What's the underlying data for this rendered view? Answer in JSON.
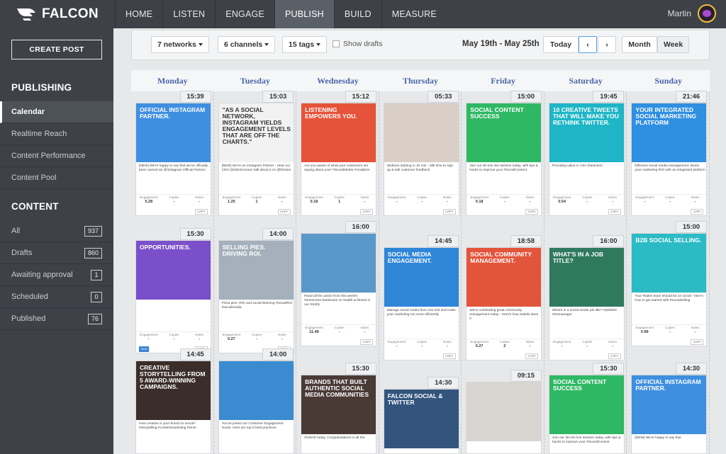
{
  "brand": {
    "name": "FALCON"
  },
  "nav": [
    "HOME",
    "LISTEN",
    "ENGAGE",
    "PUBLISH",
    "BUILD",
    "MEASURE"
  ],
  "nav_active": "PUBLISH",
  "user": {
    "name": "Martin"
  },
  "sidebar": {
    "create_post": "CREATE POST",
    "publishing_title": "PUBLISHING",
    "publishing_items": [
      {
        "label": "Calendar",
        "active": true
      },
      {
        "label": "Realtime Reach"
      },
      {
        "label": "Content Performance"
      },
      {
        "label": "Content Pool"
      }
    ],
    "content_title": "CONTENT",
    "content_items": [
      {
        "label": "All",
        "count": "937"
      },
      {
        "label": "Drafts",
        "count": "860"
      },
      {
        "label": "Awaiting approval",
        "count": "1"
      },
      {
        "label": "Scheduled",
        "count": "0"
      },
      {
        "label": "Published",
        "count": "76"
      }
    ]
  },
  "toolbar": {
    "networks": "7 networks",
    "channels": "6 channels",
    "tags": "15 tags",
    "show_drafts": "Show drafts",
    "date_range": "May 19th - May 25th",
    "today": "Today",
    "prev": "‹",
    "next": "›",
    "month": "Month",
    "week": "Week"
  },
  "colors": {
    "accent": "#4a67a8",
    "sidebar": "#3e4148",
    "active_nav": "#5b6068"
  },
  "days": [
    "Monday",
    "Tuesday",
    "Wednesday",
    "Thursday",
    "Friday",
    "Saturday",
    "Sunday"
  ],
  "columns": [
    [
      {
        "time": "15:39",
        "headline": "Official Instagram Partner.",
        "color": "#3f8fe0",
        "text": "[NEW] We're happy to say that we've officially been named an @instagram Official Partner:",
        "eng": "5.28",
        "copies": "-",
        "notes": "-"
      },
      {
        "time": "15:30",
        "headline": "OPPORTUNITIES.",
        "color": "#7b4fc9",
        "text": "",
        "eng": "-",
        "copies": "-",
        "notes": "-",
        "sent": "Sent"
      },
      {
        "time": "14:45",
        "headline": "CREATIVE STORYTELLING FROM 5 AWARD-WINNING CAMPAIGNS.",
        "color": "#3b2e2a",
        "text": "How creative is your brand on social? #storytelling #contentmarketing #smm"
      }
    ],
    [
      {
        "time": "15:03",
        "headline": "\"As a social network, Instagram yields engagement levels that are off the charts.\"",
        "color": "#f2f2f2",
        "text": "[NEW] We're an Instagram Partner - Hear our CEO @silentcrooner talk about it on @bizwire",
        "eng": "1.25",
        "copies": "1",
        "notes": "-"
      },
      {
        "time": "14:00",
        "headline": "SELLING PIES. DRIVING ROI.",
        "color": "#a4b0bb",
        "text": "Pizza pies, ROI and social listening #socialROI #socialmedia",
        "eng": "0.27",
        "copies": "-",
        "notes": "-"
      },
      {
        "time": "14:00",
        "headline": "",
        "color": "#3a8bd0",
        "text": "You've joined our Customer Engagement Guide. Here are top 5 best practices"
      }
    ],
    [
      {
        "time": "15:12",
        "headline": "LISTENING EMPOWERS YOU.",
        "color": "#e5533a",
        "text": "Are you aware of what your customers are saying about you? #SocialMedia #Analytics",
        "eng": "0.18",
        "copies": "1",
        "notes": "-"
      },
      {
        "time": "16:00",
        "headline": "",
        "color": "#5a98c9",
        "text": "Read all the action from this week's #smtoronto livestream on health & fitness in our Storify",
        "eng": "11.49",
        "copies": "-",
        "notes": "-"
      },
      {
        "time": "15:30",
        "headline": "BRANDS THAT BUILT AUTHENTIC SOCIAL MEDIA COMMUNITIES",
        "color": "#4a3a36",
        "text": "#CMAD today. Congratulations to all the"
      }
    ],
    [
      {
        "time": "05:33",
        "headline": "",
        "color": "#d9cfc6",
        "text": "Webinar starting in 10 min - Still time to sign up & talk customer feedback",
        "eng": "-",
        "copies": "-",
        "notes": "-"
      },
      {
        "time": "14:45",
        "headline": "SOCIAL MEDIA ENGAGEMENT.",
        "color": "#2f86d8",
        "text": "Manage social media from one tool and make your marketing run more efficiently",
        "eng": "-",
        "copies": "-",
        "notes": "-"
      },
      {
        "time": "14:30",
        "headline": "FALCON SOCIAL & TWITTER",
        "color": "#33557d",
        "text": ""
      }
    ],
    [
      {
        "time": "15:00",
        "headline": "Social Content Success",
        "color": "#2fb864",
        "text": "Join our 30-min live session today, with tips & hacks to improve your #SocialContent",
        "eng": "0.18",
        "copies": "-",
        "notes": "-"
      },
      {
        "time": "18:58",
        "headline": "SOCIAL COMMUNITY MANAGEMENT.",
        "color": "#e3553b",
        "text": "We're celebrating great community management today - Here's how Stabilo does it",
        "eng": "0.27",
        "copies": "2",
        "notes": "-"
      },
      {
        "time": "09:15",
        "headline": "",
        "color": "#d8d4cf",
        "text": ""
      }
    ],
    [
      {
        "time": "19:45",
        "headline": "10 CREATIVE TWEETS THAT WILL MAKE YOU RETHINK TWITTER.",
        "color": "#1eb5c6",
        "text": "Providing value in 140 characters",
        "eng": "0.54",
        "copies": "-",
        "notes": "-"
      },
      {
        "time": "16:00",
        "headline": "WHAT'S IN A JOB TITLE?",
        "color": "#2f7a5f",
        "text": "What's in a social media job title? #jobtitles #smmanager",
        "eng": "-",
        "copies": "-",
        "notes": "-"
      },
      {
        "time": "15:30",
        "headline": "Social Content Success",
        "color": "#2fb864",
        "text": "Join our 30-min live session today, with tips & hacks to improve your #SocialContent"
      }
    ],
    [
      {
        "time": "21:46",
        "headline": "Your Integrated Social Marketing Platform",
        "color": "#2f8fe0",
        "text": "Effective social media management. Boost your marketing ROI with an integrated platform",
        "eng": "-",
        "copies": "-",
        "notes": "-"
      },
      {
        "time": "15:00",
        "headline": "B2B SOCIAL SELLING.",
        "color": "#2bbbc4",
        "text": "Your #sales team should be on social - here's how to get started with #socialselling",
        "eng": "0.99",
        "copies": "-",
        "notes": "-"
      },
      {
        "time": "14:30",
        "headline": "Official Instagram Partner.",
        "color": "#3f8fe0",
        "text": "[NEW] We're happy to say that"
      }
    ]
  ],
  "stat_labels": {
    "eng": "Engagement",
    "copies": "Copies",
    "notes": "Notes",
    "copy": "COPY"
  }
}
